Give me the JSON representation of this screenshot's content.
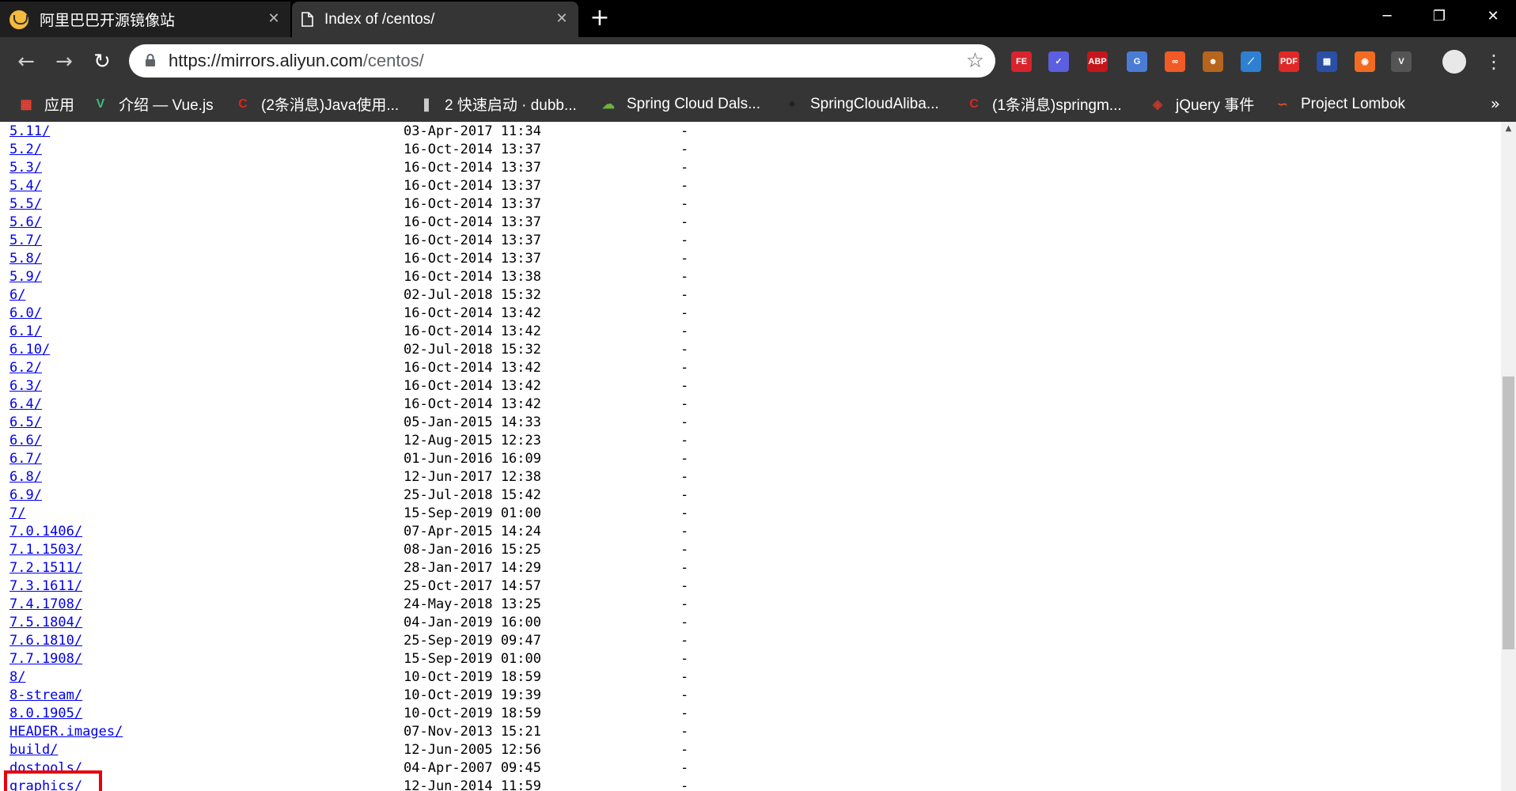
{
  "tabs": [
    {
      "title": "阿里巴巴开源镜像站",
      "icon": "alibaba-mirror-favicon"
    },
    {
      "title": "Index of /centos/",
      "icon": "page-icon"
    }
  ],
  "window_controls": {
    "minimize": "─",
    "restore": "❐",
    "close": "✕"
  },
  "toolbar": {
    "back": "←",
    "forward": "→",
    "reload": "↻",
    "url_host": "https://mirrors.aliyun.com",
    "url_path": "/centos/",
    "star": "☆",
    "extensions": [
      {
        "name": "fe-helper-extension-icon",
        "label": "FE",
        "color": "#d9232d"
      },
      {
        "name": "check-extension-icon",
        "label": "✓",
        "color": "#5b5fe0"
      },
      {
        "name": "adblock-plus-extension-icon",
        "label": "ABP",
        "color": "#c4161c"
      },
      {
        "name": "google-translate-extension-icon",
        "label": "G",
        "color": "#4a7cd6"
      },
      {
        "name": "infinity-extension-icon",
        "label": "∞",
        "color": "#f05a24"
      },
      {
        "name": "monkey-extension-icon",
        "label": "☻",
        "color": "#b5651d"
      },
      {
        "name": "feather-extension-icon",
        "label": "⟋",
        "color": "#2f80d1"
      },
      {
        "name": "pdf-extension-icon",
        "label": "PDF",
        "color": "#e02828"
      },
      {
        "name": "flag-extension-icon",
        "label": "▦",
        "color": "#2a4fa5"
      },
      {
        "name": "orange-circle-extension-icon",
        "label": "◉",
        "color": "#f26b21"
      },
      {
        "name": "vimium-extension-icon",
        "label": "V",
        "color": "#555555"
      }
    ],
    "menu": "⋮"
  },
  "bookmarks": [
    {
      "label": "应用",
      "icon": "apps-grid-icon",
      "color": "#e94235"
    },
    {
      "label": "介绍 — Vue.js",
      "icon": "vue-logo-icon",
      "color": "#41b883"
    },
    {
      "label": "(2条消息)Java使用...",
      "icon": "csdn-logo-icon",
      "color": "#e0241c"
    },
    {
      "label": "2 快速启动 · dubb...",
      "icon": "book-icon",
      "color": "#cccccc"
    },
    {
      "label": "Spring Cloud Dals...",
      "icon": "spring-cloud-icon",
      "color": "#6db33f"
    },
    {
      "label": "SpringCloudAliba...",
      "icon": "github-icon",
      "color": "#222222"
    },
    {
      "label": "(1条消息)springm...",
      "icon": "csdn-logo-icon",
      "color": "#e0241c"
    },
    {
      "label": "jQuery 事件",
      "icon": "runoob-icon",
      "color": "#c0392b"
    },
    {
      "label": "Project Lombok",
      "icon": "lombok-chili-icon",
      "color": "#e04a2f"
    }
  ],
  "bookmarks_more": "»",
  "listing": [
    {
      "name": "5.11/",
      "date": "03-Apr-2017 11:34",
      "size": "-"
    },
    {
      "name": "5.2/",
      "date": "16-Oct-2014 13:37",
      "size": "-"
    },
    {
      "name": "5.3/",
      "date": "16-Oct-2014 13:37",
      "size": "-"
    },
    {
      "name": "5.4/",
      "date": "16-Oct-2014 13:37",
      "size": "-"
    },
    {
      "name": "5.5/",
      "date": "16-Oct-2014 13:37",
      "size": "-"
    },
    {
      "name": "5.6/",
      "date": "16-Oct-2014 13:37",
      "size": "-"
    },
    {
      "name": "5.7/",
      "date": "16-Oct-2014 13:37",
      "size": "-"
    },
    {
      "name": "5.8/",
      "date": "16-Oct-2014 13:37",
      "size": "-"
    },
    {
      "name": "5.9/",
      "date": "16-Oct-2014 13:38",
      "size": "-"
    },
    {
      "name": "6/",
      "date": "02-Jul-2018 15:32",
      "size": "-"
    },
    {
      "name": "6.0/",
      "date": "16-Oct-2014 13:42",
      "size": "-"
    },
    {
      "name": "6.1/",
      "date": "16-Oct-2014 13:42",
      "size": "-"
    },
    {
      "name": "6.10/",
      "date": "02-Jul-2018 15:32",
      "size": "-"
    },
    {
      "name": "6.2/",
      "date": "16-Oct-2014 13:42",
      "size": "-"
    },
    {
      "name": "6.3/",
      "date": "16-Oct-2014 13:42",
      "size": "-"
    },
    {
      "name": "6.4/",
      "date": "16-Oct-2014 13:42",
      "size": "-"
    },
    {
      "name": "6.5/",
      "date": "05-Jan-2015 14:33",
      "size": "-"
    },
    {
      "name": "6.6/",
      "date": "12-Aug-2015 12:23",
      "size": "-"
    },
    {
      "name": "6.7/",
      "date": "01-Jun-2016 16:09",
      "size": "-"
    },
    {
      "name": "6.8/",
      "date": "12-Jun-2017 12:38",
      "size": "-"
    },
    {
      "name": "6.9/",
      "date": "25-Jul-2018 15:42",
      "size": "-"
    },
    {
      "name": "7/",
      "date": "15-Sep-2019 01:00",
      "size": "-"
    },
    {
      "name": "7.0.1406/",
      "date": "07-Apr-2015 14:24",
      "size": "-"
    },
    {
      "name": "7.1.1503/",
      "date": "08-Jan-2016 15:25",
      "size": "-"
    },
    {
      "name": "7.2.1511/",
      "date": "28-Jan-2017 14:29",
      "size": "-"
    },
    {
      "name": "7.3.1611/",
      "date": "25-Oct-2017 14:57",
      "size": "-"
    },
    {
      "name": "7.4.1708/",
      "date": "24-May-2018 13:25",
      "size": "-"
    },
    {
      "name": "7.5.1804/",
      "date": "04-Jan-2019 16:00",
      "size": "-"
    },
    {
      "name": "7.6.1810/",
      "date": "25-Sep-2019 09:47",
      "size": "-"
    },
    {
      "name": "7.7.1908/",
      "date": "15-Sep-2019 01:00",
      "size": "-",
      "highlighted": true
    },
    {
      "name": "8/",
      "date": "10-Oct-2019 18:59",
      "size": "-"
    },
    {
      "name": "8-stream/",
      "date": "10-Oct-2019 19:39",
      "size": "-"
    },
    {
      "name": "8.0.1905/",
      "date": "10-Oct-2019 18:59",
      "size": "-"
    },
    {
      "name": "HEADER.images/",
      "date": "07-Nov-2013 15:21",
      "size": "-"
    },
    {
      "name": "build/",
      "date": "12-Jun-2005 12:56",
      "size": "-"
    },
    {
      "name": "dostools/",
      "date": "04-Apr-2007 09:45",
      "size": "-"
    },
    {
      "name": "graphics/",
      "date": "12-Jun-2014 11:59",
      "size": "-"
    }
  ],
  "annotation": {
    "color": "#e8000b"
  }
}
